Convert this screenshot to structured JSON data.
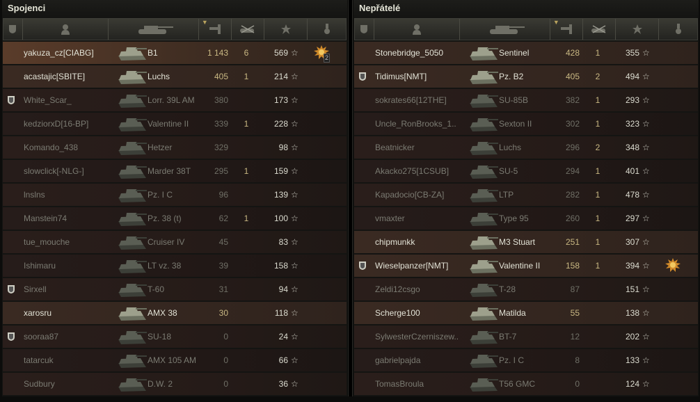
{
  "allies": {
    "title": "Spojenci",
    "players": [
      {
        "name": "yakuza_cz[CIABG]",
        "tank": "B1",
        "damage": "1 143",
        "frags": "6",
        "xp": "569",
        "platoon": false,
        "medal": true,
        "medal_count": "2",
        "style": "self"
      },
      {
        "name": "acastajic[SBITE]",
        "tank": "Luchs",
        "damage": "405",
        "frags": "1",
        "xp": "214",
        "platoon": false,
        "medal": false,
        "style": "active"
      },
      {
        "name": "White_Scar_",
        "tank": "Lorr. 39L AM",
        "damage": "380",
        "frags": "",
        "xp": "173",
        "platoon": true,
        "medal": false,
        "style": "dead"
      },
      {
        "name": "kedziorxD[16-BP]",
        "tank": "Valentine II",
        "damage": "339",
        "frags": "1",
        "xp": "228",
        "platoon": false,
        "medal": false,
        "style": "dead"
      },
      {
        "name": "Komando_438",
        "tank": "Hetzer",
        "damage": "329",
        "frags": "",
        "xp": "98",
        "platoon": false,
        "medal": false,
        "style": "dead"
      },
      {
        "name": "slowclick[-NLG-]",
        "tank": "Marder 38T",
        "damage": "295",
        "frags": "1",
        "xp": "159",
        "platoon": false,
        "medal": false,
        "style": "dead"
      },
      {
        "name": "lnslns",
        "tank": "Pz. I C",
        "damage": "96",
        "frags": "",
        "xp": "139",
        "platoon": false,
        "medal": false,
        "style": "dead"
      },
      {
        "name": "Manstein74",
        "tank": "Pz. 38 (t)",
        "damage": "62",
        "frags": "1",
        "xp": "100",
        "platoon": false,
        "medal": false,
        "style": "dead"
      },
      {
        "name": "tue_mouche",
        "tank": "Cruiser IV",
        "damage": "45",
        "frags": "",
        "xp": "83",
        "platoon": false,
        "medal": false,
        "style": "dead"
      },
      {
        "name": "Ishimaru",
        "tank": "LT vz. 38",
        "damage": "39",
        "frags": "",
        "xp": "158",
        "platoon": false,
        "medal": false,
        "style": "dead"
      },
      {
        "name": "Sirxell",
        "tank": "T-60",
        "damage": "31",
        "frags": "",
        "xp": "94",
        "platoon": true,
        "medal": false,
        "style": "dead"
      },
      {
        "name": "xarosru",
        "tank": "AMX 38",
        "damage": "30",
        "frags": "",
        "xp": "118",
        "platoon": false,
        "medal": false,
        "style": "active"
      },
      {
        "name": "sooraa87",
        "tank": "SU-18",
        "damage": "0",
        "frags": "",
        "xp": "24",
        "platoon": true,
        "medal": false,
        "style": "dead"
      },
      {
        "name": "tatarcuk",
        "tank": "AMX 105 AM",
        "damage": "0",
        "frags": "",
        "xp": "66",
        "platoon": false,
        "medal": false,
        "style": "dead"
      },
      {
        "name": "Sudbury",
        "tank": "D.W. 2",
        "damage": "0",
        "frags": "",
        "xp": "36",
        "platoon": false,
        "medal": false,
        "style": "dead"
      }
    ]
  },
  "enemies": {
    "title": "Nepřátelé",
    "players": [
      {
        "name": "Stonebridge_5050",
        "tank": "Sentinel",
        "damage": "428",
        "frags": "1",
        "xp": "355",
        "platoon": false,
        "medal": false,
        "style": "active"
      },
      {
        "name": "Tidimus[NMT]",
        "tank": "Pz. B2",
        "damage": "405",
        "frags": "2",
        "xp": "494",
        "platoon": true,
        "medal": false,
        "style": "active"
      },
      {
        "name": "sokrates66[12THE]",
        "tank": "SU-85B",
        "damage": "382",
        "frags": "1",
        "xp": "293",
        "platoon": false,
        "medal": false,
        "style": "dead"
      },
      {
        "name": "Uncle_RonBrooks_1..",
        "tank": "Sexton II",
        "damage": "302",
        "frags": "1",
        "xp": "323",
        "platoon": false,
        "medal": false,
        "style": "dead"
      },
      {
        "name": "Beatnicker",
        "tank": "Luchs",
        "damage": "296",
        "frags": "2",
        "xp": "348",
        "platoon": false,
        "medal": false,
        "style": "dead"
      },
      {
        "name": "Akacko275[1CSUB]",
        "tank": "SU-5",
        "damage": "294",
        "frags": "1",
        "xp": "401",
        "platoon": false,
        "medal": false,
        "style": "dead"
      },
      {
        "name": "Kapadocio[CB-ZA]",
        "tank": "LTP",
        "damage": "282",
        "frags": "1",
        "xp": "478",
        "platoon": false,
        "medal": false,
        "style": "dead"
      },
      {
        "name": "vmaxter",
        "tank": "Type 95",
        "damage": "260",
        "frags": "1",
        "xp": "297",
        "platoon": false,
        "medal": false,
        "style": "dead"
      },
      {
        "name": "chipmunkk",
        "tank": "M3 Stuart",
        "damage": "251",
        "frags": "1",
        "xp": "307",
        "platoon": false,
        "medal": false,
        "style": "active"
      },
      {
        "name": "Wieselpanzer[NMT]",
        "tank": "Valentine II",
        "damage": "158",
        "frags": "1",
        "xp": "394",
        "platoon": true,
        "medal": true,
        "medal_count": "",
        "style": "active"
      },
      {
        "name": "Zeldi12csgo",
        "tank": "T-28",
        "damage": "87",
        "frags": "",
        "xp": "151",
        "platoon": false,
        "medal": false,
        "style": "dead"
      },
      {
        "name": "Scherge100",
        "tank": "Matilda",
        "damage": "55",
        "frags": "",
        "xp": "138",
        "platoon": false,
        "medal": false,
        "style": "active"
      },
      {
        "name": "SylwesterCzerniszew..",
        "tank": "BT-7",
        "damage": "12",
        "frags": "",
        "xp": "202",
        "platoon": false,
        "medal": false,
        "style": "dead"
      },
      {
        "name": "gabrielpajda",
        "tank": "Pz. I C",
        "damage": "8",
        "frags": "",
        "xp": "133",
        "platoon": false,
        "medal": false,
        "style": "dead"
      },
      {
        "name": "TomasBroula",
        "tank": "T56 GMC",
        "damage": "0",
        "frags": "",
        "xp": "124",
        "platoon": false,
        "medal": false,
        "style": "dead"
      }
    ]
  },
  "icons": {
    "platoon": "platoon-shield-icon",
    "player": "player-icon",
    "tank": "tank-icon",
    "damage": "damage-icon",
    "frags": "frags-icon",
    "xp": "star-icon",
    "medal": "medal-icon"
  },
  "colors": {
    "accent_gold": "#c9b883",
    "text_alive": "#e2e2d6",
    "text_dead": "#7b7b72"
  }
}
